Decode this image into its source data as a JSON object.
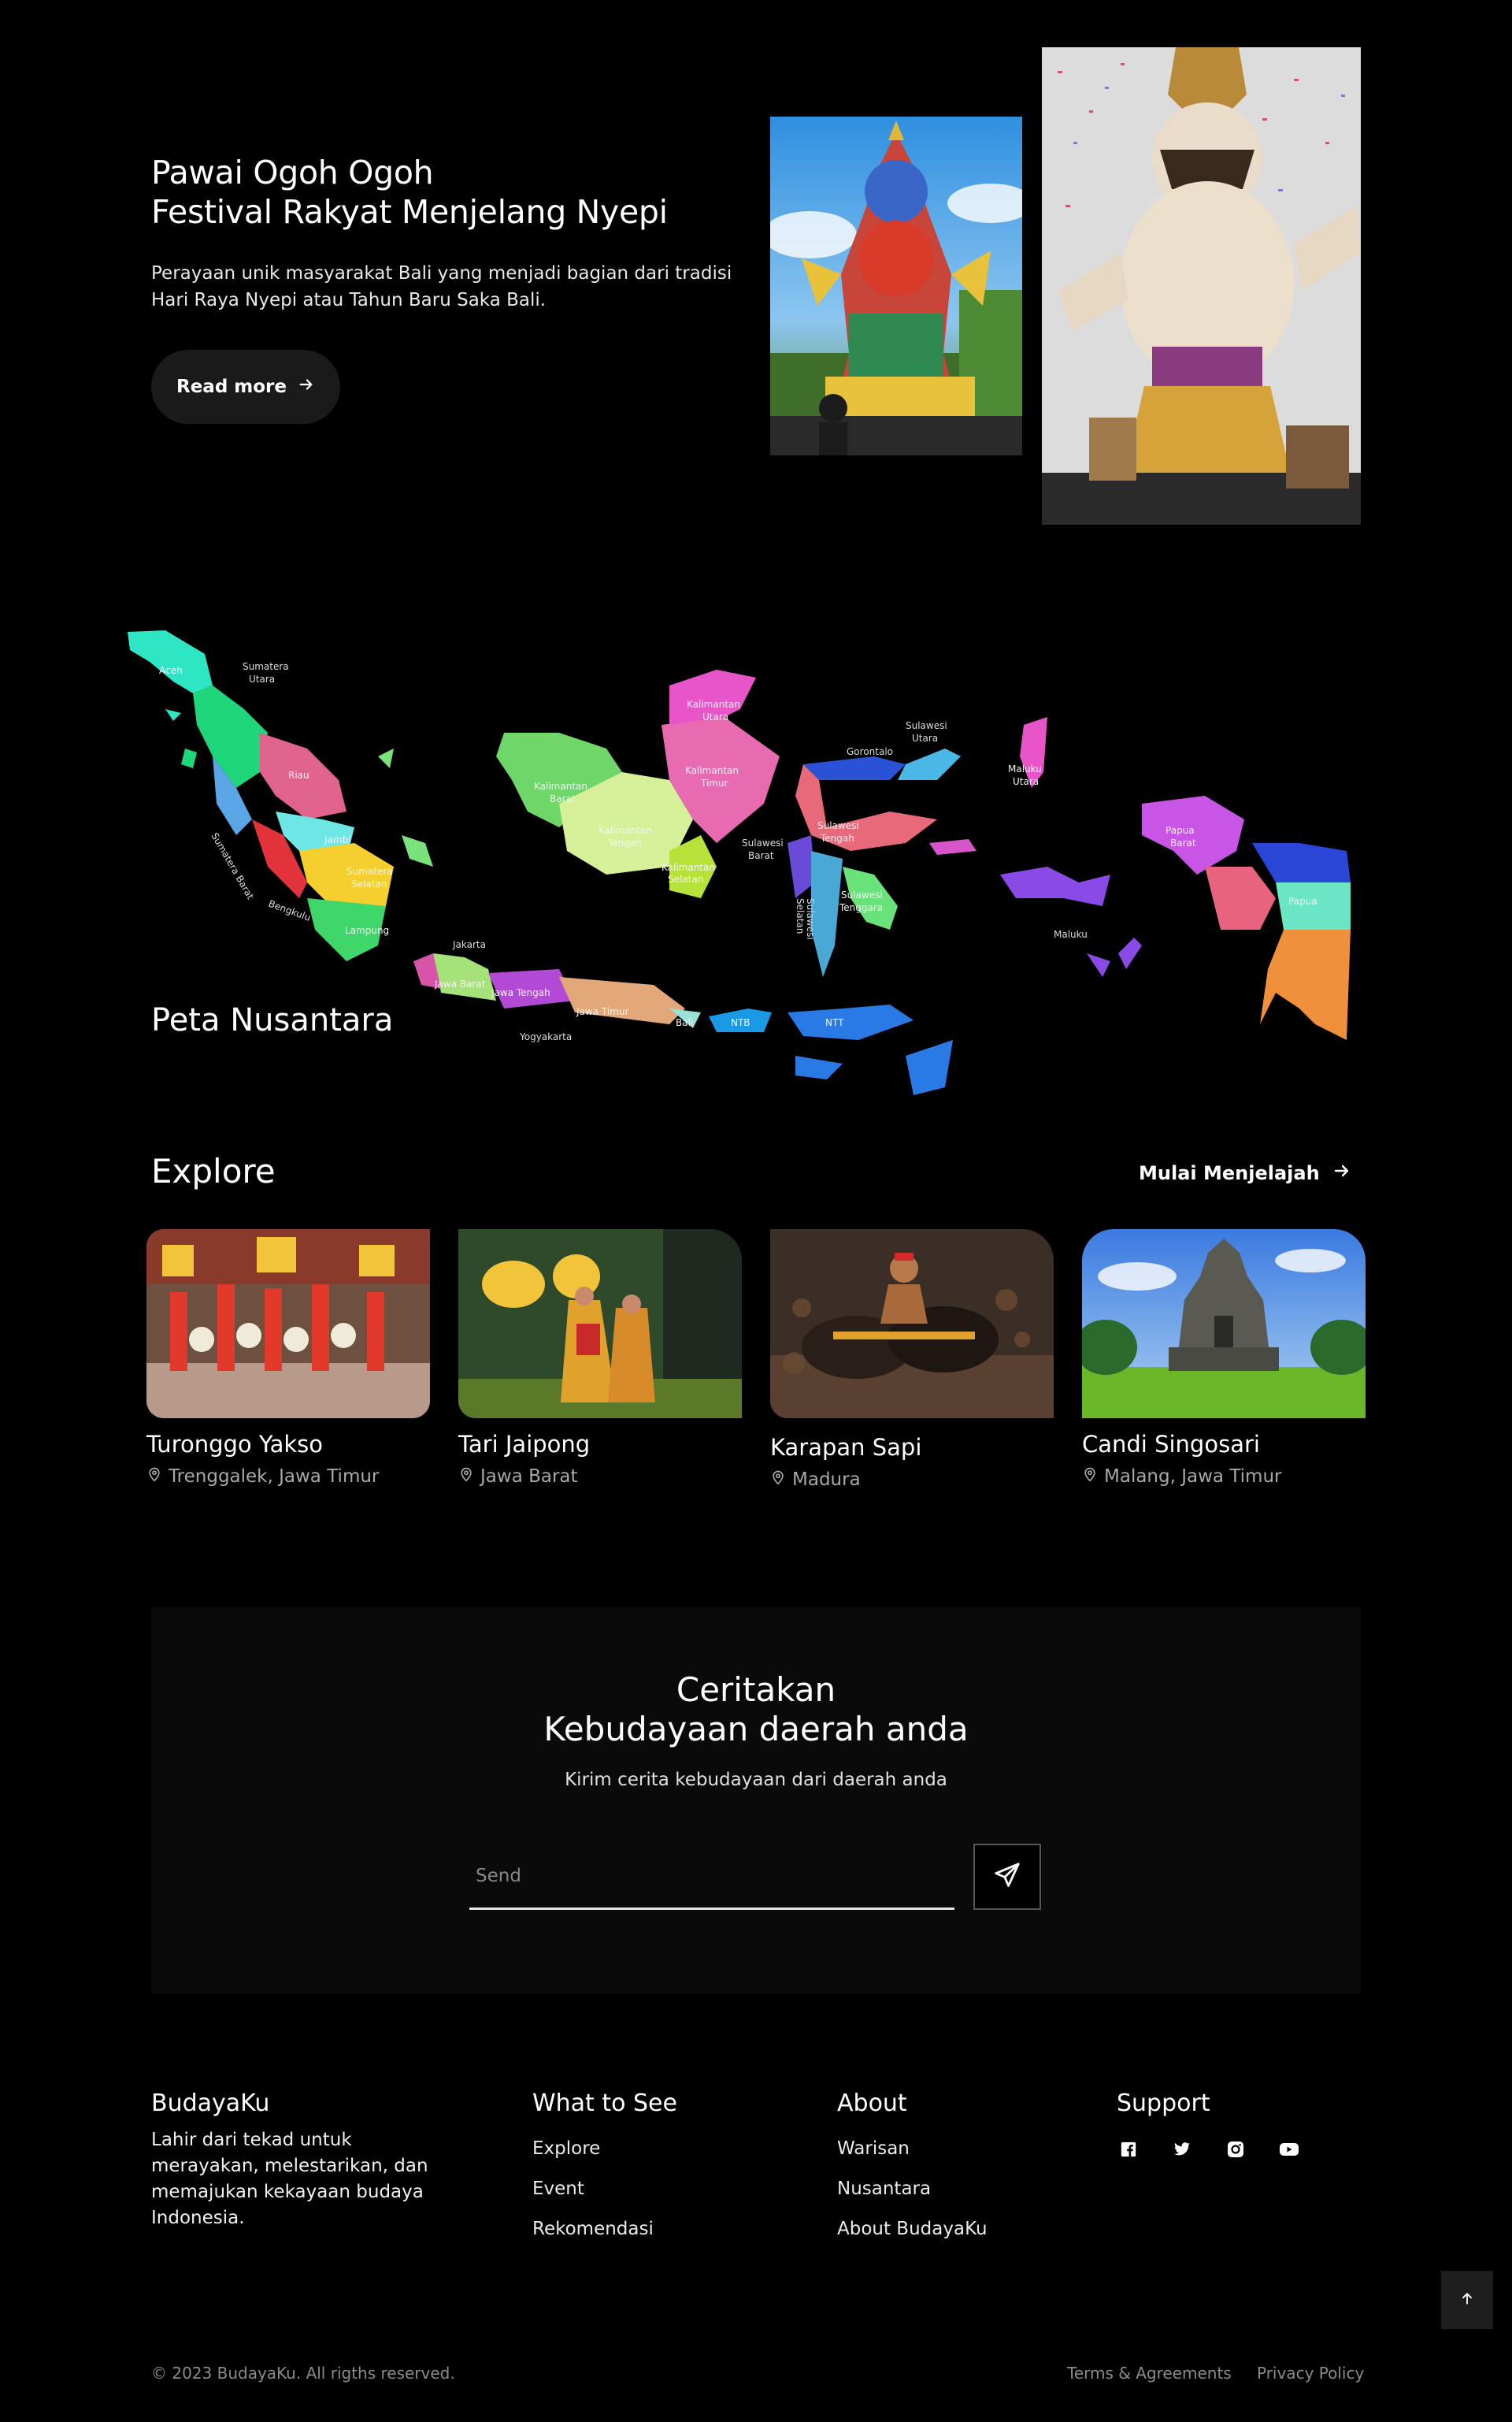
{
  "hero": {
    "title_line1": "Pawai Ogoh Ogoh",
    "title_line2": "Festival Rakyat Menjelang Nyepi",
    "description": "Perayaan unik masyarakat Bali yang menjadi bagian dari tradisi Hari Raya Nyepi atau Tahun Baru Saka Bali.",
    "read_more": "Read more"
  },
  "map": {
    "title": "Peta Nusantara",
    "labels": {
      "aceh": "Aceh",
      "sumatera_utara_1": "Sumatera",
      "sumatera_utara_2": "Utara",
      "riau": "Riau",
      "jambi": "Jambi",
      "sumatera_barat": "Sumatera Barat",
      "sumatera_selatan_1": "Sumatera",
      "sumatera_selatan_2": "Selatan",
      "bengkulu": "Bengkulu",
      "lampung": "Lampung",
      "jakarta": "Jakarta",
      "jawa_barat": "Jawa Barat",
      "jawa_tengah": "Jawa Tengah",
      "jawa_timur": "Jawa Timur",
      "yogyakarta": "Yogyakarta",
      "bali": "Bali",
      "ntb": "NTB",
      "ntt": "NTT",
      "kalbar_1": "Kalimantan",
      "kalbar_2": "Barat",
      "kalteng_1": "Kalimantan",
      "kalteng_2": "Tengah",
      "kalsel_1": "Kalimantan",
      "kalsel_2": "Selatan",
      "kaltim_1": "Kalimantan",
      "kaltim_2": "Timur",
      "kalut_1": "Kalimantan",
      "kalut_2": "Utara",
      "gorontalo": "Gorontalo",
      "sulut_1": "Sulawesi",
      "sulut_2": "Utara",
      "sulbar_1": "Sulawesi",
      "sulbar_2": "Barat",
      "sulteng_1": "Sulawesi",
      "sulteng_2": "Tengah",
      "sultra_1": "Sulawesi",
      "sultra_2": "Tenggara",
      "sulsel_1": "Sulawesi",
      "sulsel_2": "Selatan",
      "malut_1": "Maluku",
      "malut_2": "Utara",
      "maluku": "Maluku",
      "papbar_1": "Papua",
      "papbar_2": "Barat",
      "papua": "Papua"
    }
  },
  "explore": {
    "title": "Explore",
    "link": "Mulai Menjelajah",
    "cards": [
      {
        "title": "Turonggo Yakso",
        "location": "Trenggalek, Jawa Timur"
      },
      {
        "title": "Tari Jaipong",
        "location": "Jawa Barat"
      },
      {
        "title": "Karapan Sapi",
        "location": "Madura"
      },
      {
        "title": "Candi Singosari",
        "location": "Malang, Jawa Timur"
      }
    ]
  },
  "cta": {
    "title_line1": "Ceritakan",
    "title_line2": "Kebudayaan daerah anda",
    "subtitle": "Kirim cerita kebudayaan dari daerah anda",
    "placeholder": "Send"
  },
  "footer": {
    "brand": "BudayaKu",
    "brand_desc": "Lahir dari tekad untuk merayakan, melestarikan, dan memajukan kekayaan budaya Indonesia.",
    "what_to_see": {
      "heading": "What to See",
      "links": [
        "Explore",
        "Event",
        "Rekomendasi"
      ]
    },
    "about": {
      "heading": "About",
      "links": [
        "Warisan",
        "Nusantara",
        "About BudayaKu"
      ]
    },
    "support": {
      "heading": "Support"
    },
    "copyright": "© 2023 BudayaKu. All rigths reserved.",
    "terms": "Terms & Agreements",
    "privacy": "Privacy Policy"
  }
}
